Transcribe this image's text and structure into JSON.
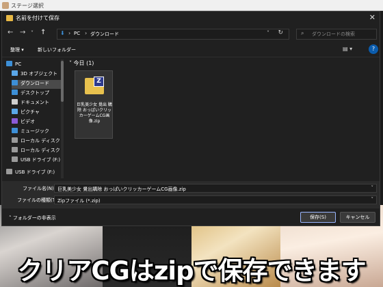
{
  "background_window": {
    "title": "ステージ選択"
  },
  "dialog": {
    "title": "名前を付けて保存",
    "nav": {
      "back": "←",
      "forward": "→",
      "dropdown": "˅",
      "up": "↑"
    },
    "address": {
      "segments": [
        "PC",
        "ダウンロード"
      ]
    },
    "search": {
      "placeholder": "ダウンロードの検索"
    },
    "toolbar": {
      "organize": "整理 ▾",
      "new_folder": "新しいフォルダー",
      "help": "?"
    },
    "sidebar": {
      "items": [
        {
          "label": "PC",
          "icon": "pc-icon",
          "color": "#3d8fd6"
        },
        {
          "label": "3D オブジェクト",
          "icon": "3d-objects-icon",
          "color": "#5aa7e8"
        },
        {
          "label": "ダウンロード",
          "icon": "download-icon",
          "color": "#3d8fd6"
        },
        {
          "label": "デスクトップ",
          "icon": "desktop-icon",
          "color": "#3d8fd6"
        },
        {
          "label": "ドキュメント",
          "icon": "documents-icon",
          "color": "#cfcfcf"
        },
        {
          "label": "ピクチャ",
          "icon": "pictures-icon",
          "color": "#5aa7e8"
        },
        {
          "label": "ビデオ",
          "icon": "videos-icon",
          "color": "#8a5ad6"
        },
        {
          "label": "ミュージック",
          "icon": "music-icon",
          "color": "#3d8fd6"
        },
        {
          "label": "ローカル ディスク (C",
          "icon": "drive-icon",
          "color": "#9a9a9a"
        },
        {
          "label": "ローカル ディスク (D",
          "icon": "drive-icon",
          "color": "#9a9a9a"
        },
        {
          "label": "USB ドライブ (F:)",
          "icon": "usb-icon",
          "color": "#9a9a9a"
        },
        {
          "label": "USB ドライブ (F:)",
          "icon": "usb-icon",
          "color": "#9a9a9a"
        }
      ]
    },
    "content": {
      "group_header": "今日 (1)",
      "file": {
        "name": "巨乳美少女 覺出 購除 おっぱいクリッカーゲームCG画像.zip",
        "badge": "Z"
      }
    },
    "fields": {
      "filename_label": "ファイル名(N):",
      "filename_value": "巨乳美少女 覺出購除 おっぱいクリッカーゲームCG画像.zip",
      "type_label": "ファイルの種類(T):",
      "type_value": "Zipファイル (*.zip)"
    },
    "footer": {
      "hide_folders": "フォルダーの非表示",
      "save": "保存(S)",
      "cancel": "キャンセル"
    }
  },
  "caption": "クリアCGはzipで保存できます"
}
